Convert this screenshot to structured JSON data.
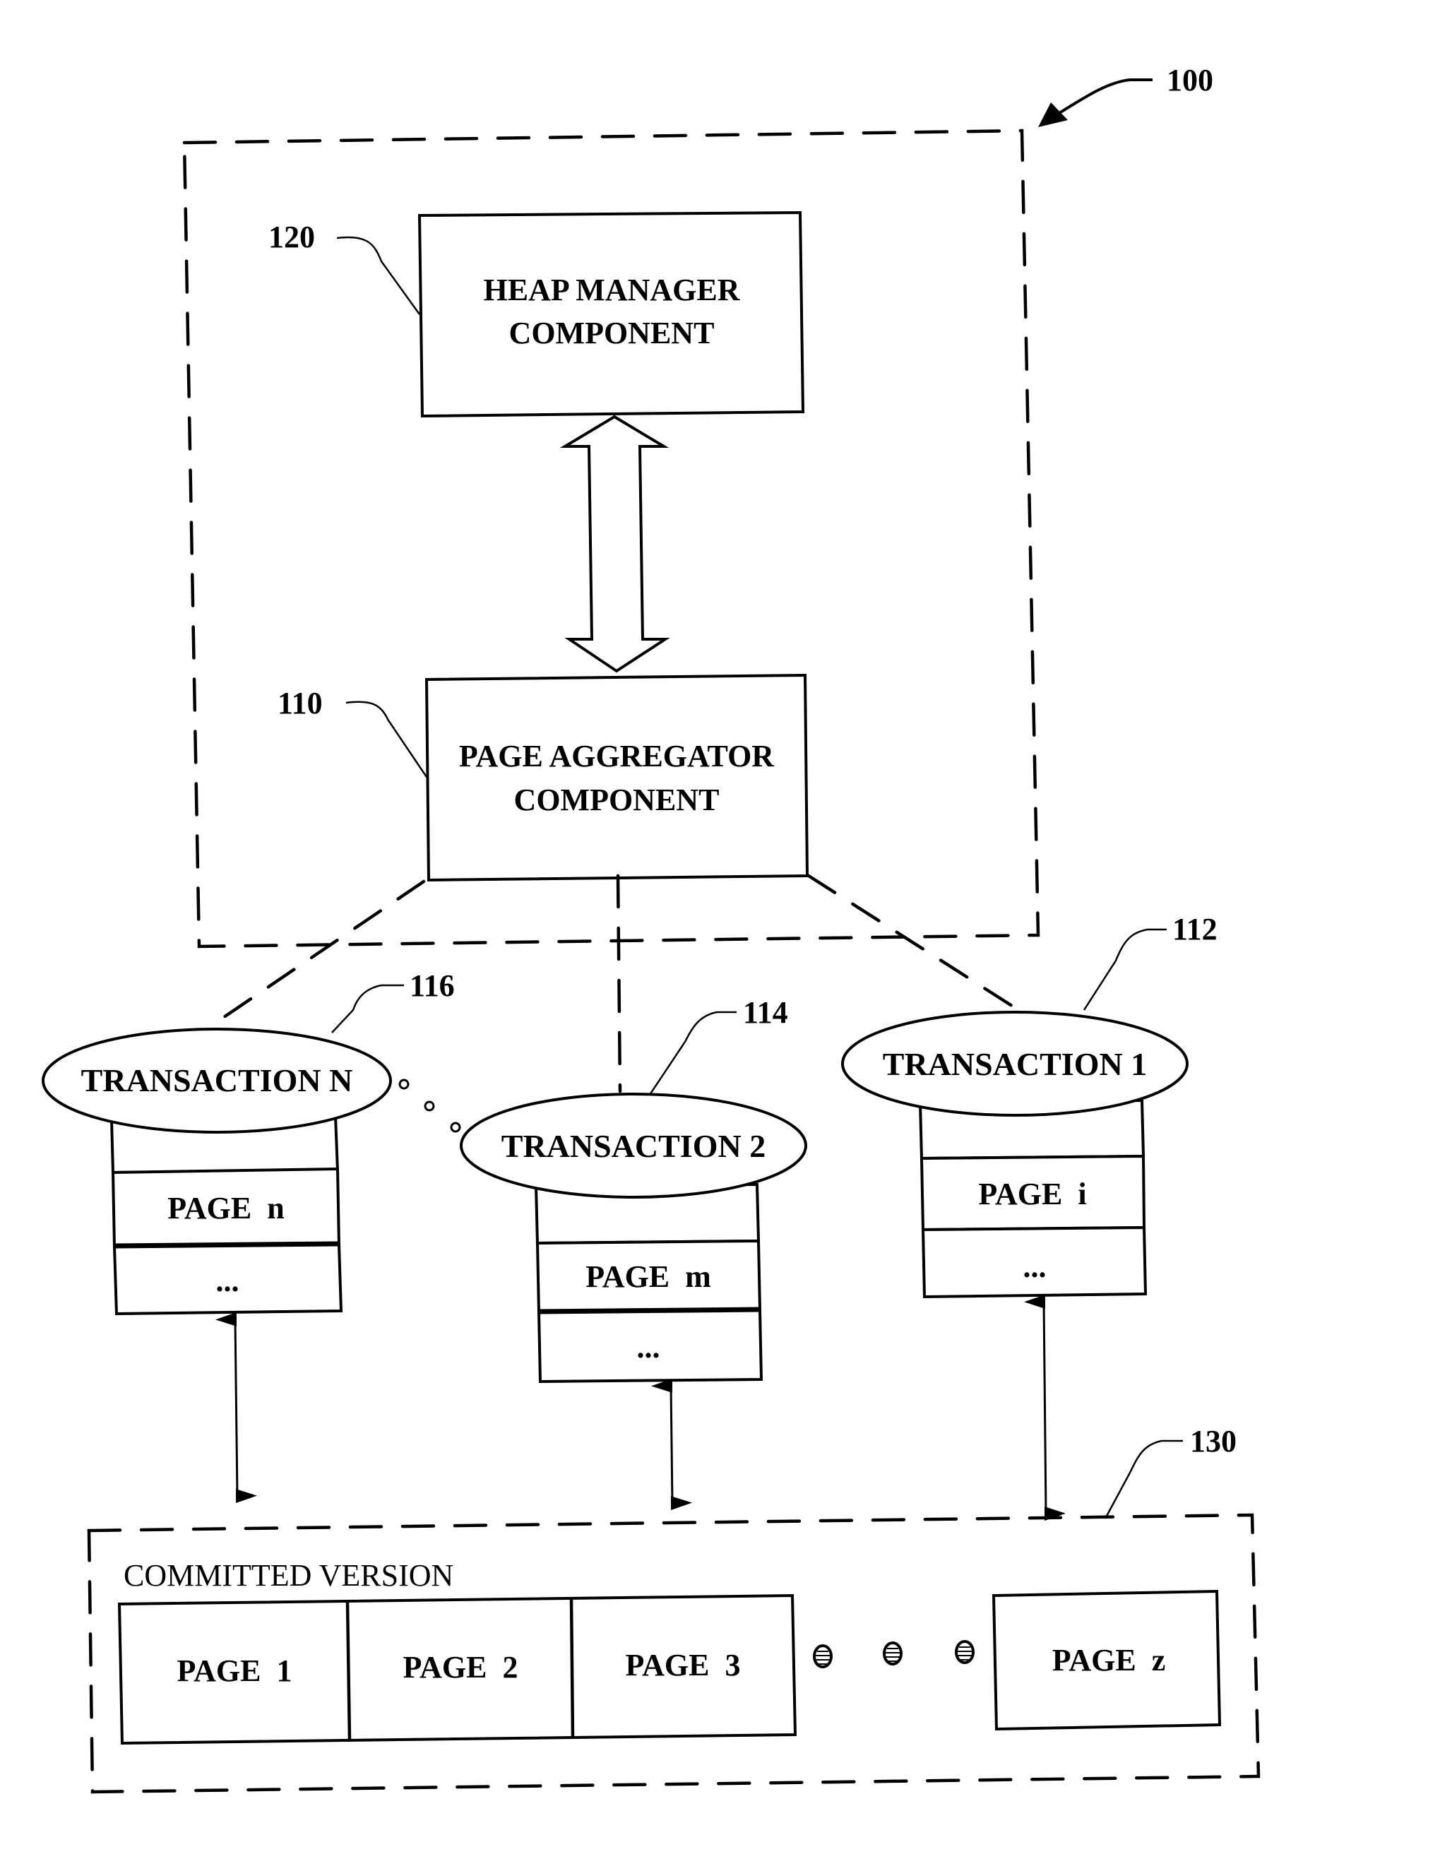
{
  "figure": {
    "reference_label": "100",
    "system_box": {
      "heap_manager": {
        "ref": "120",
        "line1": "HEAP MANAGER",
        "line2": "COMPONENT"
      },
      "page_aggregator": {
        "ref": "110",
        "line1": "PAGE AGGREGATOR",
        "line2": "COMPONENT"
      }
    },
    "transactions": [
      {
        "ref": "116",
        "label": "TRANSACTION N",
        "pages": [
          "",
          "PAGE  n",
          "..."
        ]
      },
      {
        "ref": "114",
        "label": "TRANSACTION 2",
        "pages": [
          "",
          "PAGE  m",
          "..."
        ]
      },
      {
        "ref": "112",
        "label": "TRANSACTION 1",
        "pages": [
          "",
          "PAGE  i",
          "..."
        ]
      }
    ],
    "committed_version": {
      "ref": "130",
      "title": "COMMITTED VERSION",
      "pages": [
        "PAGE  1",
        "PAGE  2",
        "PAGE  3"
      ],
      "last_page": "PAGE  z"
    }
  }
}
